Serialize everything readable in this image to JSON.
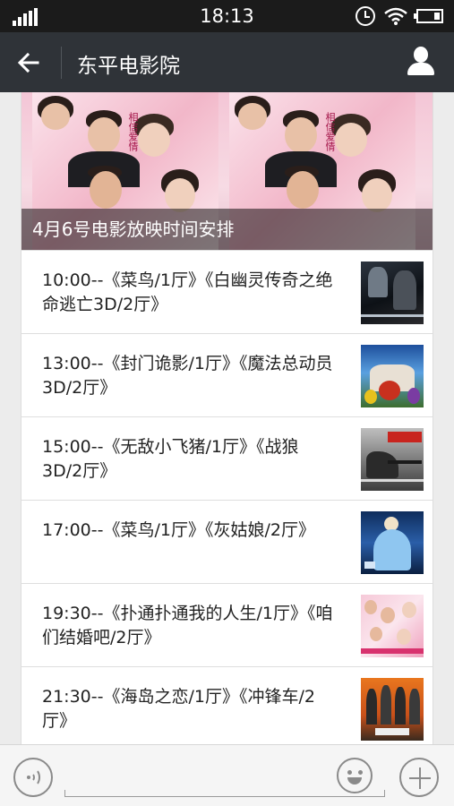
{
  "status_bar": {
    "time": "18:13"
  },
  "header": {
    "title": "东平电影院"
  },
  "banner": {
    "caption": "4月6号电影放映时间安排"
  },
  "schedule": [
    {
      "text": "10:00--《菜鸟/1厅》《白幽灵传奇之绝命逃亡3D/2厅》"
    },
    {
      "text": "13:00--《封门诡影/1厅》《魔法总动员3D/2厅》"
    },
    {
      "text": "15:00--《无敌小飞猪/1厅》《战狼3D/2厅》"
    },
    {
      "text": "17:00--《菜鸟/1厅》《灰姑娘/2厅》"
    },
    {
      "text": "19:30--《扑通扑通我的人生/1厅》《咱们结婚吧/2厅》"
    },
    {
      "text": "21:30--《海岛之恋/1厅》《冲锋车/2厅》"
    }
  ],
  "icons": {
    "back": "arrow-left-icon",
    "profile": "person-icon",
    "voice": "voice-icon",
    "emoji": "emoji-icon",
    "more": "plus-icon"
  },
  "colors": {
    "status_bar": "#1b1b1b",
    "nav_bar": "#2f3338",
    "page_bg": "#ececec"
  }
}
